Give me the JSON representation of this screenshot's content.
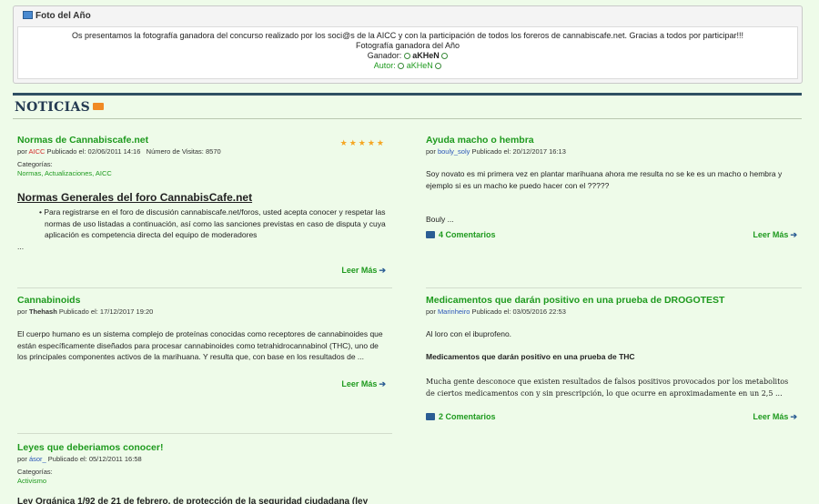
{
  "foto": {
    "title": "Foto del Año",
    "line1": "Os presentamos la fotografía ganadora del concurso realizado por los soci@s de la AICC y con la participación de todos los foreros de cannabiscafe.net. Gracias a todos por participar!!!",
    "line2": "Fotografía ganadora del Año",
    "ganador_label": "Ganador:",
    "ganador": "aKHeN",
    "autor_label": "Autor:",
    "autor": "aKHeN"
  },
  "section": {
    "title": "NOTICIAS"
  },
  "articles": {
    "a1": {
      "title": "Normas de Cannabiscafe.net",
      "por": "por",
      "author": "AICC",
      "published": "Publicado el: 02/06/2011 14:16",
      "visits": "Número de Visitas: 8570",
      "stars": "★★★★★",
      "cats_label": "Categorías:",
      "cats": "Normas, Actualizaciones, AICC",
      "heading": "Normas Generales del foro CannabisCafe.net",
      "bullet": "• Para registrarse en el foro de discusión cannabiscafe.net/foros, usted acepta conocer y respetar las normas de uso listadas a continuación, así como las sanciones previstas en caso de disputa y cuya aplicación es competencia directa del equipo de moderadores",
      "ellipsis": "...",
      "leer": "Leer Más"
    },
    "a2": {
      "title": "Ayuda macho o hembra",
      "por": "por",
      "author": "bouly_soly",
      "published": "Publicado el: 20/12/2017 16:13",
      "text": "Soy novato es mi primera vez en plantar marihuana ahora me resulta no se ke es un macho o hembra y ejemplo si es un macho ke puedo hacer con el ?????",
      "sign": "Bouly ...",
      "comments": "4 Comentarios",
      "leer": "Leer Más"
    },
    "a3": {
      "title": "Cannabinoids",
      "por": "por",
      "author": "Thehash",
      "published": "Publicado el: 17/12/2017 19:20",
      "text": "El cuerpo humano es un sistema complejo de proteínas conocidas como receptores de cannabinoides que están específicamente diseñados para procesar cannabinoides como tetrahidrocannabinol (THC), uno de los principales componentes activos de la marihuana. Y resulta que, con base en los resultados de ...",
      "leer": "Leer Más"
    },
    "a4": {
      "title": "Medicamentos que darán positivo en una prueba de DROGOTEST",
      "por": "por",
      "author": "Marinheiro",
      "published": "Publicado el: 03/05/2016 22:53",
      "line1": "Al loro con el ibuprofeno.",
      "subhead": "Medicamentos que darán positivo en una prueba de THC",
      "text": "Mucha gente desconoce que existen resultados de falsos positivos provocados por los metabolitos de ciertos medicamentos con y sin prescripción, lo que ocurre en aproximadamente en un 2,5 ...",
      "comments": "2 Comentarios",
      "leer": "Leer Más"
    },
    "a5": {
      "title": "Leyes que deberiamos conocer!",
      "por": "por",
      "author": "ásor_",
      "published": "Publicado el: 05/12/2011 16:58",
      "cats_label": "Categorías:",
      "cats": "Activismo",
      "heading": "Ley Orgánica 1/92 de 21 de febrero, de protección de la seguridad ciudadana (ley"
    }
  }
}
